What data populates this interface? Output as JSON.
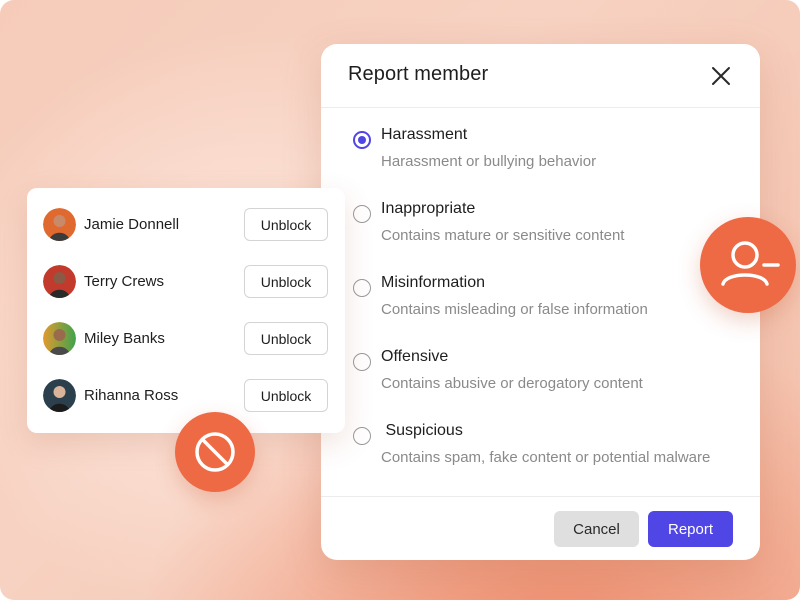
{
  "report_dialog": {
    "title": "Report member",
    "options": [
      {
        "title": "Harassment",
        "description": "Harassment or bullying behavior",
        "selected": true
      },
      {
        "title": "Inappropriate",
        "description": "Contains mature or sensitive content",
        "selected": false
      },
      {
        "title": "Misinformation",
        "description": "Contains misleading or false information",
        "selected": false
      },
      {
        "title": "Offensive",
        "description": "Contains abusive or derogatory content",
        "selected": false
      },
      {
        "title": " Suspicious",
        "description": "Contains spam, fake content or potential malware",
        "selected": false
      }
    ],
    "cancel_label": "Cancel",
    "report_label": "Report"
  },
  "blocked_users": {
    "unblock_label": "Unblock",
    "users": [
      {
        "name": "Jamie Donnell",
        "avatar_color": "#e0692f"
      },
      {
        "name": "Terry Crews",
        "avatar_color": "#c23a2c"
      },
      {
        "name": "Miley Banks",
        "avatar_color": "#3fa34d"
      },
      {
        "name": "Rihanna Ross",
        "avatar_color": "#2c3f4d"
      }
    ]
  },
  "colors": {
    "accent": "#4f46e5",
    "badge": "#ed6a45"
  },
  "icons": {
    "block_badge": "block-icon",
    "remove_user_badge": "user-minus-icon",
    "close": "close-icon"
  }
}
